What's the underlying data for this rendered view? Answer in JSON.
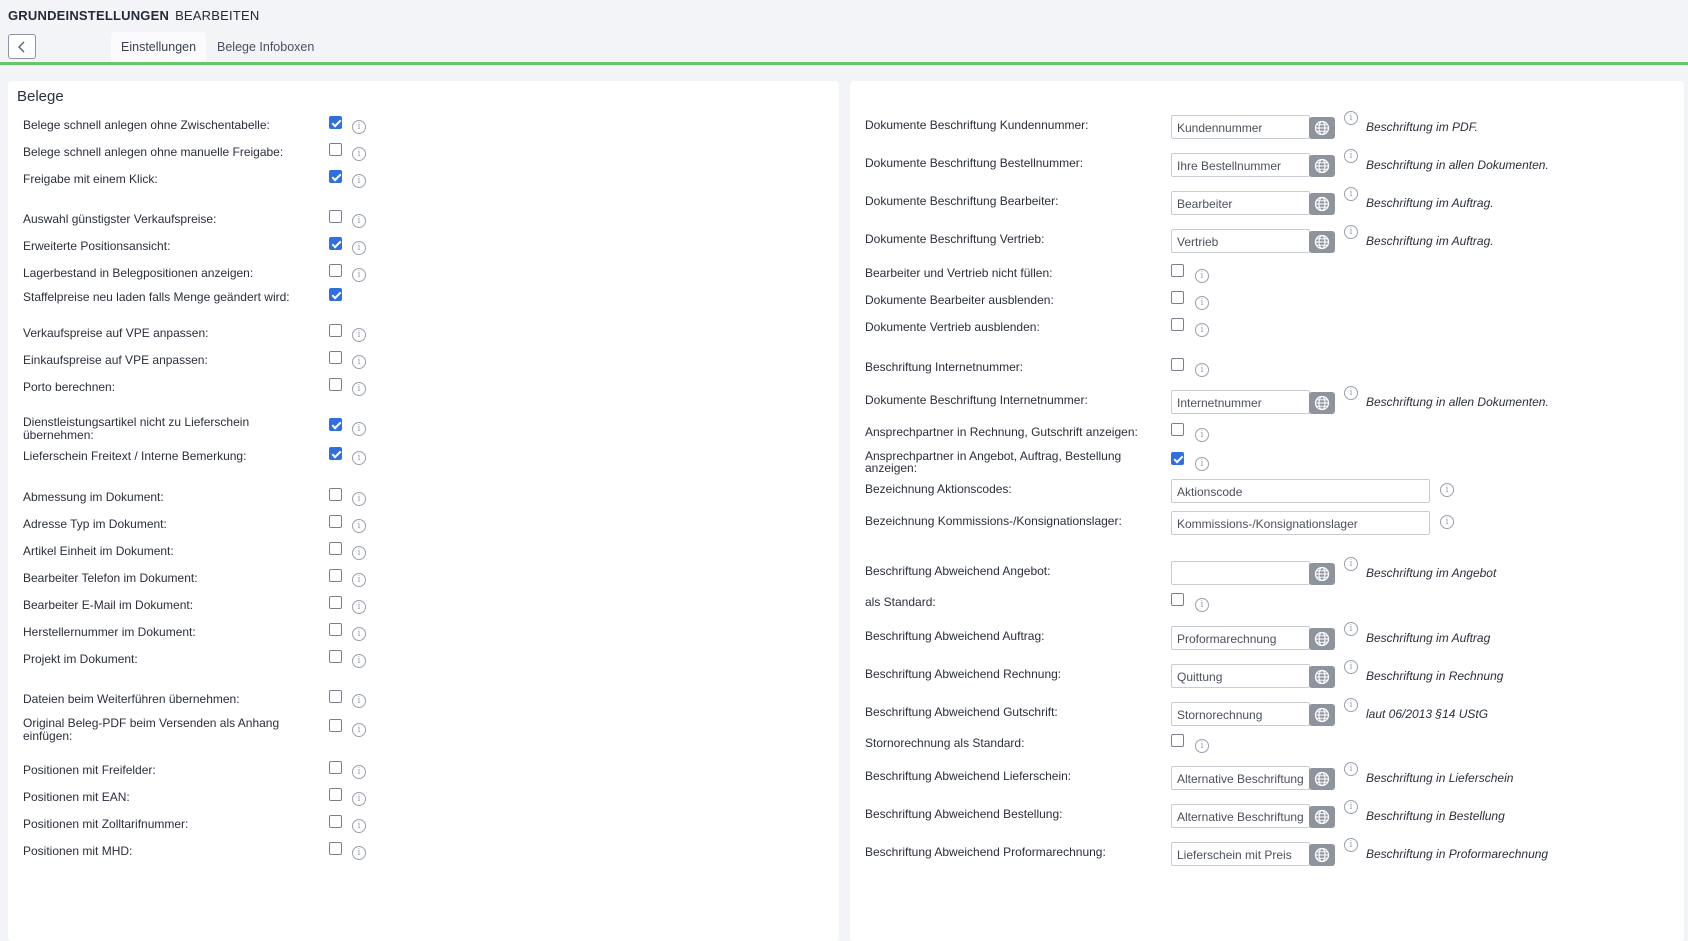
{
  "header": {
    "title_bold": "GRUNDEINSTELLUNGEN",
    "title_normal": "BEARBEITEN",
    "tabs": [
      {
        "label": "Einstellungen",
        "active": true
      },
      {
        "label": "Belege Infoboxen",
        "active": false
      }
    ],
    "accent_color": "#6cc46a"
  },
  "left_panel": {
    "title": "Belege",
    "rows": [
      {
        "label": "Belege schnell anlegen ohne Zwischentabelle:",
        "checked": true,
        "info": true
      },
      {
        "label": "Belege schnell anlegen ohne manuelle Freigabe:",
        "checked": false,
        "info": true
      },
      {
        "label": "Freigabe mit einem Klick:",
        "checked": true,
        "info": true
      },
      {
        "label": "Auswahl günstigster Verkaufspreise:",
        "checked": false,
        "info": true
      },
      {
        "label": "Erweiterte Positionsansicht:",
        "checked": true,
        "info": true
      },
      {
        "label": "Lagerbestand in Belegpositionen anzeigen:",
        "checked": false,
        "info": true
      },
      {
        "label": "Staffelpreise neu laden falls Menge geändert wird:",
        "checked": true,
        "info": false
      },
      {
        "label": "Verkaufspreise auf VPE anpassen:",
        "checked": false,
        "info": true
      },
      {
        "label": "Einkaufspreise auf VPE anpassen:",
        "checked": false,
        "info": true
      },
      {
        "label": "Porto berechnen:",
        "checked": false,
        "info": true
      },
      {
        "label": "Dienstleistungsartikel nicht zu Lieferschein übernehmen:",
        "checked": true,
        "info": true
      },
      {
        "label": "Lieferschein Freitext / Interne Bemerkung:",
        "checked": true,
        "info": true
      },
      {
        "label": "Abmessung im Dokument:",
        "checked": false,
        "info": true
      },
      {
        "label": "Adresse Typ im Dokument:",
        "checked": false,
        "info": true
      },
      {
        "label": "Artikel Einheit im Dokument:",
        "checked": false,
        "info": true
      },
      {
        "label": "Bearbeiter Telefon im Dokument:",
        "checked": false,
        "info": true
      },
      {
        "label": "Bearbeiter E-Mail im Dokument:",
        "checked": false,
        "info": true
      },
      {
        "label": "Herstellernummer im Dokument:",
        "checked": false,
        "info": true
      },
      {
        "label": "Projekt im Dokument:",
        "checked": false,
        "info": true
      },
      {
        "label": "Dateien beim Weiterführen übernehmen:",
        "checked": false,
        "info": true
      },
      {
        "label": "Original Beleg-PDF beim Versenden als Anhang einfügen:",
        "checked": false,
        "info": true
      },
      {
        "label": "Positionen mit Freifelder:",
        "checked": false,
        "info": true
      },
      {
        "label": "Positionen mit EAN:",
        "checked": false,
        "info": true
      },
      {
        "label": "Positionen mit Zolltarifnummer:",
        "checked": false,
        "info": true
      },
      {
        "label": "Positionen mit MHD:",
        "checked": false,
        "info": true
      }
    ]
  },
  "right_panel": {
    "rows": [
      {
        "label": "Dokumente Beschriftung Kundennummer:",
        "type": "text",
        "value": "Kundennummer",
        "hint": "Beschriftung im PDF."
      },
      {
        "label": "Dokumente Beschriftung Bestellnummer:",
        "type": "text",
        "value": "Ihre Bestellnummer",
        "hint": "Beschriftung in allen Dokumenten."
      },
      {
        "label": "Dokumente Beschriftung Bearbeiter:",
        "type": "text",
        "value": "Bearbeiter",
        "hint": "Beschriftung im Auftrag."
      },
      {
        "label": "Dokumente Beschriftung Vertrieb:",
        "type": "text",
        "value": "Vertrieb",
        "hint": "Beschriftung im Auftrag."
      },
      {
        "label": "Bearbeiter und Vertrieb nicht füllen:",
        "type": "checkbox",
        "checked": false
      },
      {
        "label": "Dokumente Bearbeiter ausblenden:",
        "type": "checkbox",
        "checked": false
      },
      {
        "label": "Dokumente Vertrieb ausblenden:",
        "type": "checkbox",
        "checked": false
      },
      {
        "label": "Beschriftung Internetnummer:",
        "type": "checkbox",
        "checked": false
      },
      {
        "label": "Dokumente Beschriftung Internetnummer:",
        "type": "text",
        "value": "Internetnummer",
        "hint": "Beschriftung in allen Dokumenten."
      },
      {
        "label": "Ansprechpartner in Rechnung, Gutschrift anzeigen:",
        "type": "checkbox",
        "checked": false
      },
      {
        "label": "Ansprechpartner in Angebot, Auftrag, Bestellung anzeigen:",
        "type": "checkbox",
        "checked": true
      },
      {
        "label": "Bezeichnung Aktionscodes:",
        "type": "wide",
        "value": "Aktionscode"
      },
      {
        "label": "Bezeichnung Kommissions-/Konsignationslager:",
        "type": "wide",
        "value": "Kommissions-/Konsignationslager"
      },
      {
        "label": "Beschriftung Abweichend Angebot:",
        "type": "text",
        "value": "",
        "hint": "Beschriftung im Angebot"
      },
      {
        "label": "als Standard:",
        "type": "checkbox",
        "checked": false
      },
      {
        "label": "Beschriftung Abweichend Auftrag:",
        "type": "text",
        "value": "Proformarechnung",
        "hint": "Beschriftung im Auftrag"
      },
      {
        "label": "Beschriftung Abweichend Rechnung:",
        "type": "text",
        "value": "Quittung",
        "hint": "Beschriftung in Rechnung"
      },
      {
        "label": "Beschriftung Abweichend Gutschrift:",
        "type": "text",
        "value": "Stornorechnung",
        "hint": "laut 06/2013 §14 UStG"
      },
      {
        "label": "Stornorechnung als Standard:",
        "type": "checkbox",
        "checked": false
      },
      {
        "label": "Beschriftung Abweichend Lieferschein:",
        "type": "text",
        "value": "Alternative Beschriftung",
        "hint": "Beschriftung in Lieferschein"
      },
      {
        "label": "Beschriftung Abweichend Bestellung:",
        "type": "text",
        "value": "Alternative Beschriftung",
        "hint": "Beschriftung in Bestellung"
      },
      {
        "label": "Beschriftung Abweichend Proformarechnung:",
        "type": "text",
        "value": "Lieferschein mit Preis",
        "hint": "Beschriftung in Proformarechnung"
      }
    ]
  }
}
